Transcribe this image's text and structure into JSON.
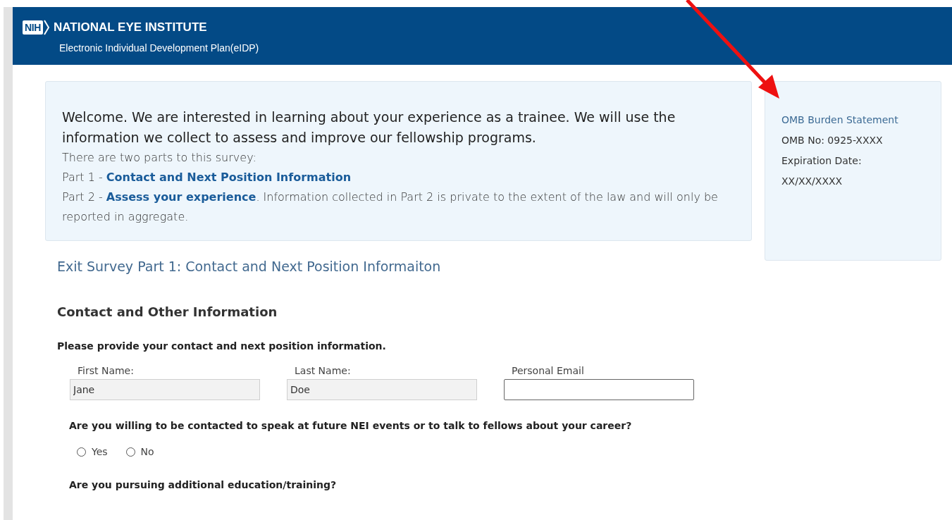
{
  "header": {
    "logo": "NIH",
    "title": "NATIONAL EYE INSTITUTE",
    "subtitle": "Electronic Individual Development Plan(eIDP)"
  },
  "intro": {
    "welcome": "Welcome. We are interested in learning about your experience as a trainee. We will use the information we collect to assess and improve our fellowship programs.",
    "lines": [
      "There are two parts to this survey:",
      "Part 1 - **Contact and Next Position Information**",
      "Part 2 - **Assess your experience**. Information collected in Part 2 is private to the extent of the law and will only be reported in aggregate."
    ]
  },
  "omb": {
    "link": "OMB Burden Statement",
    "lines": [
      "OMB No: 0925-XXXX",
      "Expiration Date:",
      "XX/XX/XXXX"
    ]
  },
  "survey_title": "Exit Survey Part 1: Contact and Next Position Informaiton",
  "section_heading": "Contact and Other Information",
  "instruction": "Please provide your contact and next position information.",
  "fields": [
    {
      "label": "First Name:",
      "value": "Jane",
      "readonly": true
    },
    {
      "label": "Last Name:",
      "value": "Doe",
      "readonly": true
    },
    {
      "label": "Personal Email",
      "readonly": false
    }
  ],
  "questions": [
    {
      "text": "Are you willing to be contacted to speak at future NEI events or to talk to fellows about your career?",
      "options": [
        {
          "label": "Yes",
          "selected": false
        },
        {
          "label": "No",
          "selected": false
        }
      ]
    },
    {
      "text": "Are you pursuing additional education/training?"
    }
  ]
}
